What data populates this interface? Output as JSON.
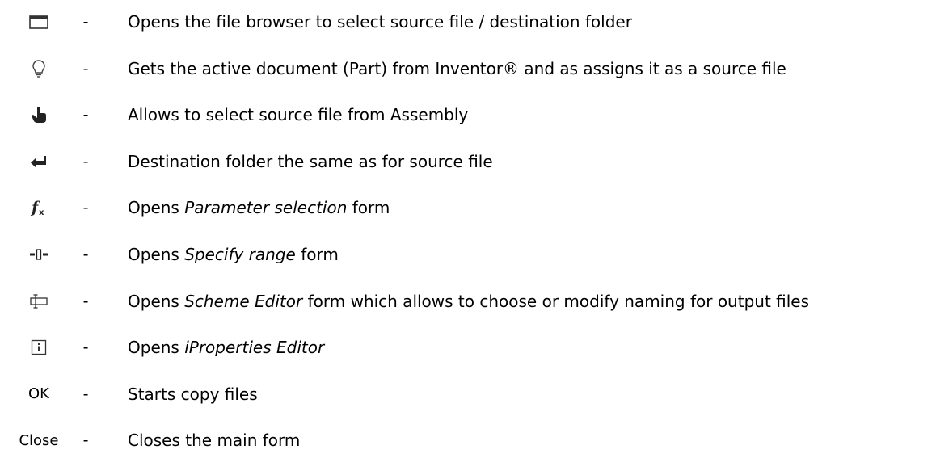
{
  "rows": [
    {
      "icon": "folder-window-icon",
      "dash": "-",
      "text": "Opens the file browser to select source file / destination folder"
    },
    {
      "icon": "lightbulb-icon",
      "dash": "-",
      "text": "Gets the active document (Part) from Inventor® and as assigns it as a source file"
    },
    {
      "icon": "pointing-hand-icon",
      "dash": "-",
      "text": "Allows to select source file from Assembly"
    },
    {
      "icon": "return-arrow-icon",
      "dash": "-",
      "text": "Destination folder the same as for source file"
    },
    {
      "icon": "function-fx-icon",
      "dash": "-",
      "pre": "Opens ",
      "em": "Parameter selection",
      "post": " form"
    },
    {
      "icon": "range-icon",
      "dash": "-",
      "pre": "Opens ",
      "em": "Specify range",
      "post": " form"
    },
    {
      "icon": "scheme-editor-icon",
      "dash": "-",
      "pre": "Opens ",
      "em": "Scheme Editor",
      "post": " form which allows to choose or modify naming for output files"
    },
    {
      "icon": "info-icon",
      "dash": "-",
      "pre": "Opens ",
      "em": "iProperties Editor",
      "post": ""
    },
    {
      "label": "OK",
      "dash": "-",
      "text": "Starts copy files"
    },
    {
      "label": "Close",
      "dash": "-",
      "text": "Closes the main form"
    }
  ]
}
